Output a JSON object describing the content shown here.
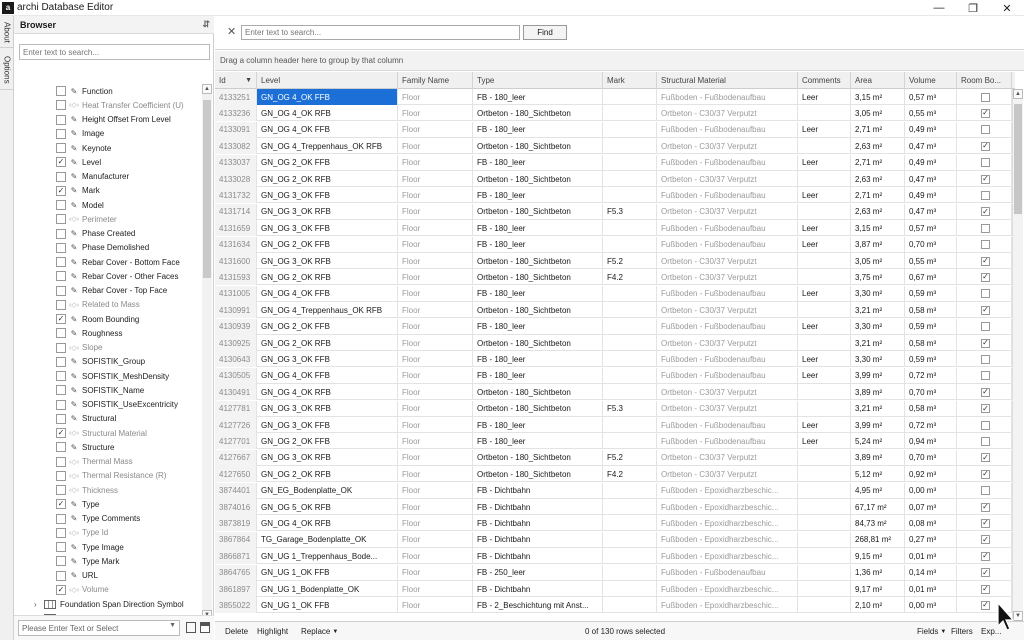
{
  "window": {
    "title": "archi Database Editor",
    "logo_glyph": "a",
    "minimize_glyph": "—",
    "maximize_glyph": "❐",
    "close_glyph": "✕"
  },
  "side_tabs": [
    "About",
    "Options"
  ],
  "browser": {
    "title": "Browser",
    "pin_glyph": "⇵",
    "search_placeholder": "Enter text to search...",
    "items": [
      {
        "label": "Function",
        "checked": false,
        "dim": false
      },
      {
        "label": "Heat Transfer Coefficient (U)",
        "checked": false,
        "dim": true
      },
      {
        "label": "Height Offset From Level",
        "checked": false,
        "dim": false
      },
      {
        "label": "Image",
        "checked": false,
        "dim": false
      },
      {
        "label": "Keynote",
        "checked": false,
        "dim": false
      },
      {
        "label": "Level",
        "checked": true,
        "dim": false
      },
      {
        "label": "Manufacturer",
        "checked": false,
        "dim": false
      },
      {
        "label": "Mark",
        "checked": true,
        "dim": false
      },
      {
        "label": "Model",
        "checked": false,
        "dim": false
      },
      {
        "label": "Perimeter",
        "checked": false,
        "dim": true
      },
      {
        "label": "Phase Created",
        "checked": false,
        "dim": false
      },
      {
        "label": "Phase Demolished",
        "checked": false,
        "dim": false
      },
      {
        "label": "Rebar Cover - Bottom Face",
        "checked": false,
        "dim": false
      },
      {
        "label": "Rebar Cover - Other Faces",
        "checked": false,
        "dim": false
      },
      {
        "label": "Rebar Cover - Top Face",
        "checked": false,
        "dim": false
      },
      {
        "label": "Related to Mass",
        "checked": false,
        "dim": true
      },
      {
        "label": "Room Bounding",
        "checked": true,
        "dim": false
      },
      {
        "label": "Roughness",
        "checked": false,
        "dim": false
      },
      {
        "label": "Slope",
        "checked": false,
        "dim": true
      },
      {
        "label": "SOFISTIK_Group",
        "checked": false,
        "dim": false
      },
      {
        "label": "SOFISTIK_MeshDensity",
        "checked": false,
        "dim": false
      },
      {
        "label": "SOFISTIK_Name",
        "checked": false,
        "dim": false
      },
      {
        "label": "SOFISTIK_UseExcentricity",
        "checked": false,
        "dim": false
      },
      {
        "label": "Structural",
        "checked": false,
        "dim": false
      },
      {
        "label": "Structural Material",
        "checked": true,
        "dim": true
      },
      {
        "label": "Structure",
        "checked": false,
        "dim": false
      },
      {
        "label": "Thermal Mass",
        "checked": false,
        "dim": true
      },
      {
        "label": "Thermal Resistance (R)",
        "checked": false,
        "dim": true
      },
      {
        "label": "Thickness",
        "checked": false,
        "dim": true
      },
      {
        "label": "Type",
        "checked": true,
        "dim": false
      },
      {
        "label": "Type Comments",
        "checked": false,
        "dim": false
      },
      {
        "label": "Type Id",
        "checked": false,
        "dim": true
      },
      {
        "label": "Type Image",
        "checked": false,
        "dim": false
      },
      {
        "label": "Type Mark",
        "checked": false,
        "dim": false
      },
      {
        "label": "URL",
        "checked": false,
        "dim": false
      },
      {
        "label": "Volume",
        "checked": true,
        "dim": true
      }
    ],
    "groups": [
      {
        "label": "Foundation Span Direction Symbol"
      },
      {
        "label": "Furniture"
      }
    ],
    "bottom_placeholder": "Please Enter Text or Select"
  },
  "main": {
    "search_placeholder": "Enter text to search...",
    "find_label": "Find",
    "group_hint": "Drag a column header here to group by that column",
    "columns": [
      "Id",
      "Level",
      "Family Name",
      "Type",
      "Mark",
      "Structural Material",
      "Comments",
      "Area",
      "Volume",
      "Room Bo..."
    ],
    "rows": [
      [
        "4133251",
        "GN_OG 4_OK FFB",
        "Floor",
        "FB - 180_leer",
        "",
        "Fußboden - Fußbodenaufbau",
        "Leer",
        "3,15 m²",
        "0,57 m³",
        false
      ],
      [
        "4133236",
        "GN_OG 4_OK RFB",
        "Floor",
        "Ortbeton - 180_Sichtbeton",
        "",
        "Ortbeton - C30/37 Verputzt",
        "",
        "3,05 m²",
        "0,55 m³",
        true
      ],
      [
        "4133091",
        "GN_OG 4_OK FFB",
        "Floor",
        "FB - 180_leer",
        "",
        "Fußboden - Fußbodenaufbau",
        "Leer",
        "2,71 m²",
        "0,49 m³",
        false
      ],
      [
        "4133082",
        "GN_OG 4_Treppenhaus_OK RFB",
        "Floor",
        "Ortbeton - 180_Sichtbeton",
        "",
        "Ortbeton - C30/37 Verputzt",
        "",
        "2,63 m²",
        "0,47 m³",
        true
      ],
      [
        "4133037",
        "GN_OG 2_OK FFB",
        "Floor",
        "FB - 180_leer",
        "",
        "Fußboden - Fußbodenaufbau",
        "Leer",
        "2,71 m²",
        "0,49 m³",
        false
      ],
      [
        "4133028",
        "GN_OG 2_OK RFB",
        "Floor",
        "Ortbeton - 180_Sichtbeton",
        "",
        "Ortbeton - C30/37 Verputzt",
        "",
        "2,63 m²",
        "0,47 m³",
        true
      ],
      [
        "4131732",
        "GN_OG 3_OK FFB",
        "Floor",
        "FB - 180_leer",
        "",
        "Fußboden - Fußbodenaufbau",
        "Leer",
        "2,71 m²",
        "0,49 m³",
        false
      ],
      [
        "4131714",
        "GN_OG 3_OK RFB",
        "Floor",
        "Ortbeton - 180_Sichtbeton",
        "F5.3",
        "Ortbeton - C30/37 Verputzt",
        "",
        "2,63 m²",
        "0,47 m³",
        true
      ],
      [
        "4131659",
        "GN_OG 3_OK FFB",
        "Floor",
        "FB - 180_leer",
        "",
        "Fußboden - Fußbodenaufbau",
        "Leer",
        "3,15 m²",
        "0,57 m³",
        false
      ],
      [
        "4131634",
        "GN_OG 2_OK FFB",
        "Floor",
        "FB - 180_leer",
        "",
        "Fußboden - Fußbodenaufbau",
        "Leer",
        "3,87 m²",
        "0,70 m³",
        false
      ],
      [
        "4131600",
        "GN_OG 3_OK RFB",
        "Floor",
        "Ortbeton - 180_Sichtbeton",
        "F5.2",
        "Ortbeton - C30/37 Verputzt",
        "",
        "3,05 m²",
        "0,55 m³",
        true
      ],
      [
        "4131593",
        "GN_OG 2_OK RFB",
        "Floor",
        "Ortbeton - 180_Sichtbeton",
        "F4.2",
        "Ortbeton - C30/37 Verputzt",
        "",
        "3,75 m²",
        "0,67 m³",
        true
      ],
      [
        "4131005",
        "GN_OG 4_OK FFB",
        "Floor",
        "FB - 180_leer",
        "",
        "Fußboden - Fußbodenaufbau",
        "Leer",
        "3,30 m²",
        "0,59 m³",
        false
      ],
      [
        "4130991",
        "GN_OG 4_Treppenhaus_OK RFB",
        "Floor",
        "Ortbeton - 180_Sichtbeton",
        "",
        "Ortbeton - C30/37 Verputzt",
        "",
        "3,21 m²",
        "0,58 m³",
        true
      ],
      [
        "4130939",
        "GN_OG 2_OK FFB",
        "Floor",
        "FB - 180_leer",
        "",
        "Fußboden - Fußbodenaufbau",
        "Leer",
        "3,30 m²",
        "0,59 m³",
        false
      ],
      [
        "4130925",
        "GN_OG 2_OK RFB",
        "Floor",
        "Ortbeton - 180_Sichtbeton",
        "",
        "Ortbeton - C30/37 Verputzt",
        "",
        "3,21 m²",
        "0,58 m³",
        true
      ],
      [
        "4130643",
        "GN_OG 3_OK FFB",
        "Floor",
        "FB - 180_leer",
        "",
        "Fußboden - Fußbodenaufbau",
        "Leer",
        "3,30 m²",
        "0,59 m³",
        false
      ],
      [
        "4130505",
        "GN_OG 4_OK FFB",
        "Floor",
        "FB - 180_leer",
        "",
        "Fußboden - Fußbodenaufbau",
        "Leer",
        "3,99 m²",
        "0,72 m³",
        false
      ],
      [
        "4130491",
        "GN_OG 4_OK RFB",
        "Floor",
        "Ortbeton - 180_Sichtbeton",
        "",
        "Ortbeton - C30/37 Verputzt",
        "",
        "3,89 m²",
        "0,70 m³",
        true
      ],
      [
        "4127781",
        "GN_OG 3_OK RFB",
        "Floor",
        "Ortbeton - 180_Sichtbeton",
        "F5.3",
        "Ortbeton - C30/37 Verputzt",
        "",
        "3,21 m²",
        "0,58 m³",
        true
      ],
      [
        "4127726",
        "GN_OG 3_OK FFB",
        "Floor",
        "FB - 180_leer",
        "",
        "Fußboden - Fußbodenaufbau",
        "Leer",
        "3,99 m²",
        "0,72 m³",
        false
      ],
      [
        "4127701",
        "GN_OG 2_OK FFB",
        "Floor",
        "FB - 180_leer",
        "",
        "Fußboden - Fußbodenaufbau",
        "Leer",
        "5,24 m²",
        "0,94 m³",
        false
      ],
      [
        "4127667",
        "GN_OG 3_OK RFB",
        "Floor",
        "Ortbeton - 180_Sichtbeton",
        "F5.2",
        "Ortbeton - C30/37 Verputzt",
        "",
        "3,89 m²",
        "0,70 m³",
        true
      ],
      [
        "4127650",
        "GN_OG 2_OK RFB",
        "Floor",
        "Ortbeton - 180_Sichtbeton",
        "F4.2",
        "Ortbeton - C30/37 Verputzt",
        "",
        "5,12 m²",
        "0,92 m³",
        true
      ],
      [
        "3874401",
        "GN_EG_Bodenplatte_OK",
        "Floor",
        "FB - Dichtbahn",
        "",
        "Fußboden - Epoxidharzbeschic...",
        "",
        "4,95 m²",
        "0,00 m³",
        false
      ],
      [
        "3874016",
        "GN_OG 5_OK RFB",
        "Floor",
        "FB - Dichtbahn",
        "",
        "Fußboden - Epoxidharzbeschic...",
        "",
        "67,17 m²",
        "0,07 m³",
        true
      ],
      [
        "3873819",
        "GN_OG 4_OK RFB",
        "Floor",
        "FB - Dichtbahn",
        "",
        "Fußboden - Epoxidharzbeschic...",
        "",
        "84,73 m²",
        "0,08 m³",
        true
      ],
      [
        "3867864",
        "TG_Garage_Bodenplatte_OK",
        "Floor",
        "FB - Dichtbahn",
        "",
        "Fußboden - Epoxidharzbeschic...",
        "",
        "268,81 m²",
        "0,27 m³",
        true
      ],
      [
        "3866871",
        "GN_UG 1_Treppenhaus_Bode...",
        "Floor",
        "FB - Dichtbahn",
        "",
        "Fußboden - Epoxidharzbeschic...",
        "",
        "9,15 m²",
        "0,01 m³",
        true
      ],
      [
        "3864765",
        "GN_UG 1_OK FFB",
        "Floor",
        "FB - 250_leer",
        "",
        "Fußboden - Fußbodenaufbau",
        "",
        "1,36 m²",
        "0,14 m³",
        true
      ],
      [
        "3861897",
        "GN_UG 1_Bodenplatte_OK",
        "Floor",
        "FB - Dichtbahn",
        "",
        "Fußboden - Epoxidharzbeschic...",
        "",
        "9,17 m²",
        "0,01 m³",
        true
      ],
      [
        "3855022",
        "GN_UG 1_OK FFB",
        "Floor",
        "FB - 2_Beschichtung mit Anst...",
        "",
        "Fußboden - Epoxidharzbeschic...",
        "",
        "2,10 m²",
        "0,00 m³",
        true
      ]
    ],
    "selected_row": 0
  },
  "footer": {
    "delete_label": "Delete",
    "highlight_label": "Highlight",
    "replace_label": "Replace",
    "status": "0 of 130 rows selected",
    "fields_label": "Fields",
    "filters_label": "Filters",
    "export_label": "Exp..."
  },
  "colors": {
    "selection": "#1c6fd6",
    "header_bg": "#f0f0f0"
  }
}
